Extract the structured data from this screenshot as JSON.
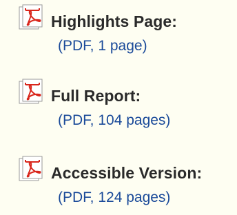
{
  "documents": [
    {
      "icon": "pdf-icon",
      "title": "Highlights Page:",
      "meta": "(PDF, 1 page)"
    },
    {
      "icon": "pdf-icon",
      "title": "Full Report:",
      "meta": "(PDF, 104 pages)"
    },
    {
      "icon": "pdf-icon",
      "title": "Accessible Version:",
      "meta": "(PDF, 124 pages)"
    }
  ],
  "colors": {
    "background": "#fefef2",
    "title_text": "#2a2a2a",
    "link_text": "#1a4a99",
    "pdf_red": "#d9261c"
  }
}
